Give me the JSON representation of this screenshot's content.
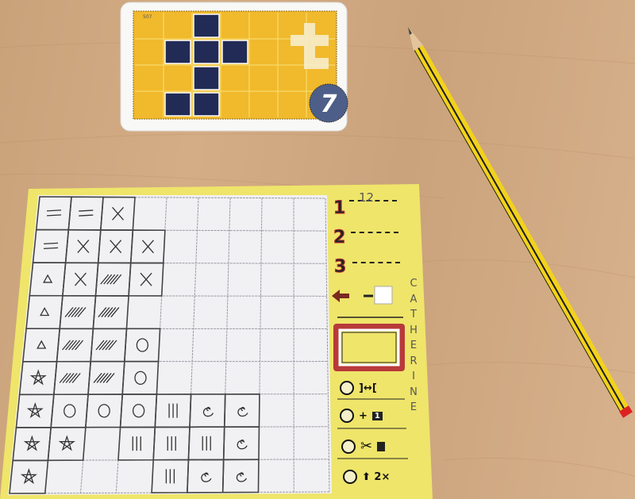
{
  "colors": {
    "table": "#cfa67e",
    "paper": "#efe56a",
    "card_yellow": "#f1b92c",
    "card_navy": "#222b55",
    "card_badge": "#4d5e88",
    "pencil_yellow": "#f2d21c",
    "pencil_stripe": "#1b1b1b",
    "frame_red": "#b8393a"
  },
  "card": {
    "code": "507",
    "number": "7",
    "grid_cols": 7,
    "grid_rows": 4,
    "filled": [
      [
        0,
        2
      ],
      [
        1,
        1
      ],
      [
        1,
        2
      ],
      [
        1,
        3
      ],
      [
        2,
        2
      ],
      [
        3,
        1
      ],
      [
        3,
        2
      ]
    ]
  },
  "sheet": {
    "grid": [
      [
        "=",
        "=",
        "X",
        "",
        "",
        "",
        "",
        "",
        ""
      ],
      [
        "=",
        "X",
        "X",
        "X",
        "",
        "",
        "",
        "",
        ""
      ],
      [
        "tri",
        "X",
        "hatch",
        "X",
        "",
        "",
        "",
        "",
        ""
      ],
      [
        "tri",
        "hatch",
        "hatch",
        "",
        "",
        "",
        "",
        "",
        ""
      ],
      [
        "tri",
        "hatch",
        "hatch",
        "O",
        "",
        "",
        "",
        "",
        ""
      ],
      [
        "star",
        "hatch",
        "hatch",
        "O",
        "",
        "",
        "",
        "",
        ""
      ],
      [
        "star",
        "O",
        "O",
        "O",
        "bars",
        "spiral",
        "spiral",
        "",
        ""
      ],
      [
        "star",
        "star",
        "",
        "bars",
        "bars",
        "bars",
        "spiral",
        "",
        ""
      ],
      [
        "star",
        "",
        "",
        "",
        "bars",
        "spiral",
        "spiral",
        "",
        ""
      ]
    ],
    "scores": [
      {
        "rank": "1",
        "value": "12"
      },
      {
        "rank": "2",
        "value": ""
      },
      {
        "rank": "3",
        "value": ""
      }
    ],
    "player_name": "CATHERINE",
    "bonuses": [
      {
        "icon": "expand-icon",
        "label": "]↔["
      },
      {
        "icon": "plus-one-icon",
        "label": "+",
        "badge": "1"
      },
      {
        "icon": "scissors-icon",
        "label": "✂"
      },
      {
        "icon": "arrow-up-icon",
        "label": "⬆ 2×"
      }
    ]
  }
}
